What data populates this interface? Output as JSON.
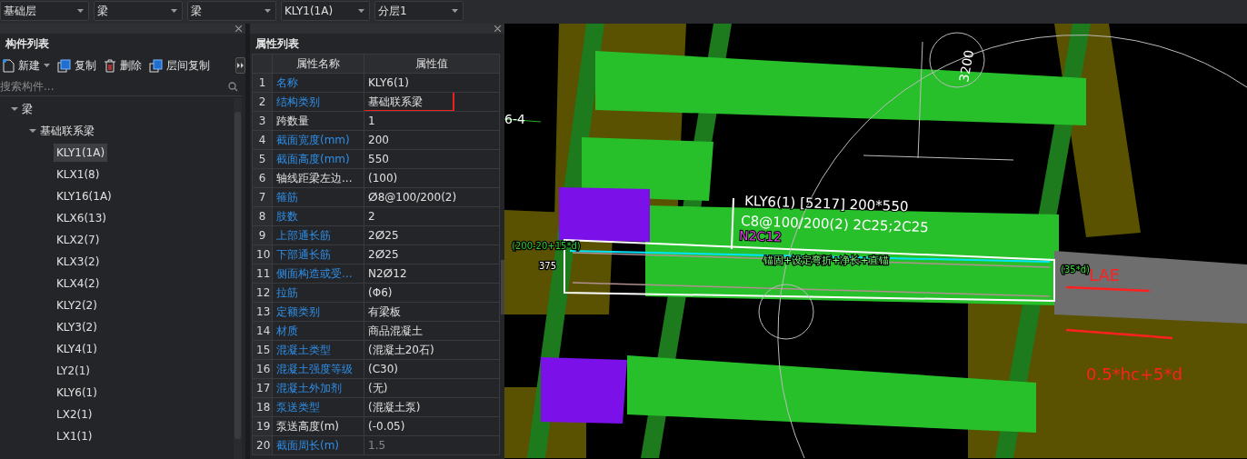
{
  "toolbar": {
    "dropdowns": [
      {
        "value": "基础层"
      },
      {
        "value": "梁"
      },
      {
        "value": "梁"
      },
      {
        "value": "KLY1(1A)"
      },
      {
        "value": "分层1"
      }
    ]
  },
  "component_panel": {
    "title": "构件列表",
    "actions": [
      {
        "label": "新建",
        "kind": "new"
      },
      {
        "label": "复制",
        "kind": "copy"
      },
      {
        "label": "删除",
        "kind": "delete"
      },
      {
        "label": "层间复制",
        "kind": "floor-copy"
      }
    ],
    "search": {
      "placeholder": "搜索构件..."
    },
    "tree": [
      {
        "label": "梁",
        "expanded": true,
        "children": [
          {
            "label": "基础联系梁",
            "expanded": true,
            "children": [
              {
                "label": "KLY1(1A)",
                "selected": true
              },
              {
                "label": "KLX1(8)",
                "selected": false
              },
              {
                "label": "KLY16(1A)",
                "selected": false
              },
              {
                "label": "KLX6(13)",
                "selected": false
              },
              {
                "label": "KLX2(7)",
                "selected": false
              },
              {
                "label": "KLX3(2)",
                "selected": false
              },
              {
                "label": "KLX4(2)",
                "selected": false
              },
              {
                "label": "KLY2(2)",
                "selected": false
              },
              {
                "label": "KLY3(2)",
                "selected": false
              },
              {
                "label": "KLY4(1)",
                "selected": false
              },
              {
                "label": "LY2(1)",
                "selected": false
              },
              {
                "label": "KLY6(1)",
                "selected": false
              },
              {
                "label": "LX2(1)",
                "selected": false
              },
              {
                "label": "LX1(1)",
                "selected": false
              }
            ]
          }
        ]
      }
    ]
  },
  "property_panel": {
    "title": "属性列表",
    "columns": [
      "属性名称",
      "属性值"
    ],
    "rows": [
      {
        "index": "1",
        "name": "名称",
        "value": "KLY6(1)",
        "public": true,
        "disabled": false,
        "annotated": false
      },
      {
        "index": "2",
        "name": "结构类别",
        "value": "基础联系梁",
        "public": true,
        "disabled": false,
        "annotated": true
      },
      {
        "index": "3",
        "name": "跨数量",
        "value": "1",
        "public": false,
        "disabled": false,
        "annotated": false
      },
      {
        "index": "4",
        "name": "截面宽度(mm)",
        "value": "200",
        "public": true,
        "disabled": false,
        "annotated": false
      },
      {
        "index": "5",
        "name": "截面高度(mm)",
        "value": "550",
        "public": true,
        "disabled": false,
        "annotated": false
      },
      {
        "index": "6",
        "name": "轴线距梁左边...",
        "value": "(100)",
        "public": false,
        "disabled": false,
        "annotated": false
      },
      {
        "index": "7",
        "name": "箍筋",
        "value": "ⵁ8@100/200(2)",
        "public": true,
        "disabled": false,
        "annotated": false
      },
      {
        "index": "8",
        "name": "肢数",
        "value": "2",
        "public": true,
        "disabled": false,
        "annotated": false
      },
      {
        "index": "9",
        "name": "上部通长筋",
        "value": "2ⵁ25",
        "public": true,
        "disabled": false,
        "annotated": false
      },
      {
        "index": "10",
        "name": "下部通长筋",
        "value": "2ⵁ25",
        "public": true,
        "disabled": false,
        "annotated": false
      },
      {
        "index": "11",
        "name": "侧面构造或受...",
        "value": "N2ⵁ12",
        "public": true,
        "disabled": false,
        "annotated": false
      },
      {
        "index": "12",
        "name": "拉筋",
        "value": "(Φ6)",
        "public": true,
        "disabled": false,
        "annotated": false
      },
      {
        "index": "13",
        "name": "定额类别",
        "value": "有梁板",
        "public": true,
        "disabled": false,
        "annotated": false
      },
      {
        "index": "14",
        "name": "材质",
        "value": "商品混凝土",
        "public": true,
        "disabled": false,
        "annotated": false
      },
      {
        "index": "15",
        "name": "混凝土类型",
        "value": "(混凝土20石)",
        "public": true,
        "disabled": false,
        "annotated": false
      },
      {
        "index": "16",
        "name": "混凝土强度等级",
        "value": "(C30)",
        "public": true,
        "disabled": false,
        "annotated": false
      },
      {
        "index": "17",
        "name": "混凝土外加剂",
        "value": "(无)",
        "public": true,
        "disabled": false,
        "annotated": false
      },
      {
        "index": "18",
        "name": "泵送类型",
        "value": "(混凝土泵)",
        "public": true,
        "disabled": false,
        "annotated": false
      },
      {
        "index": "19",
        "name": "泵送高度(m)",
        "value": "(-0.05)",
        "public": false,
        "disabled": false,
        "annotated": false
      },
      {
        "index": "20",
        "name": "截面周长(m)",
        "value": "1.5",
        "public": true,
        "disabled": true,
        "annotated": false
      }
    ]
  },
  "viewport": {
    "axis_label": "6-4",
    "dimension": "3200",
    "beam_label": [
      "KLY6(1) [5217] 200*550",
      "C8@100/200(2) 2C25;2C25"
    ],
    "side_bar_label": "N2C12",
    "rebar_notes": [
      {
        "text": "(200-20+15*d)",
        "kind": "left"
      },
      {
        "text": "375",
        "kind": "offset"
      },
      {
        "text": "锚固+设定弯折+净长+直锚",
        "kind": "formula"
      },
      {
        "text": "(35*d)",
        "kind": "right"
      }
    ],
    "annotations": [
      "LAE",
      "0.5*hc+5*d"
    ]
  }
}
